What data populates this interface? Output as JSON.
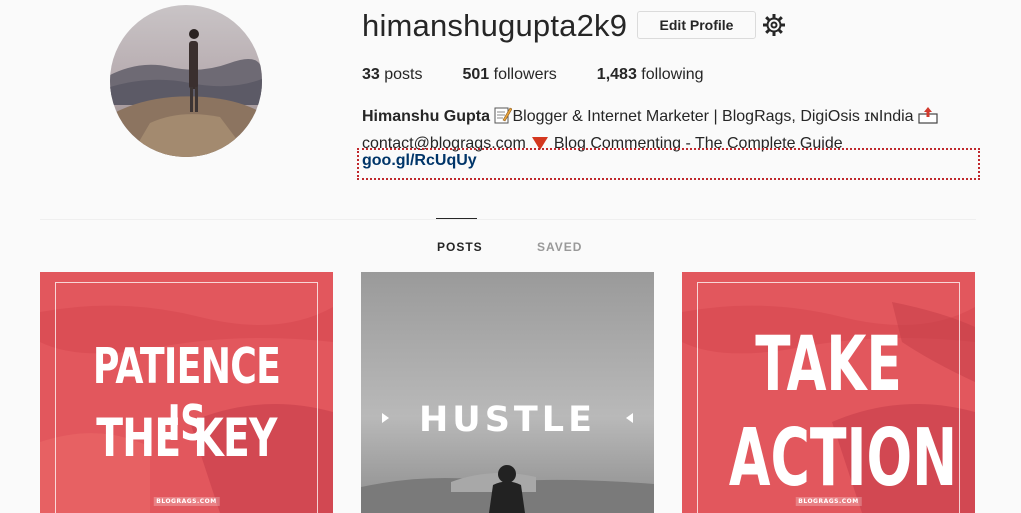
{
  "profile": {
    "username": "himanshugupta2k9",
    "edit_label": "Edit Profile",
    "stats": {
      "posts_count": "33",
      "posts_label": "posts",
      "followers_count": "501",
      "followers_label": "followers",
      "following_count": "1,483",
      "following_label": "following"
    },
    "bio": {
      "name": "Himanshu Gupta",
      "line1_text": "Blogger & Internet Marketer | BlogRags, DigiOsis ɪɴIndia",
      "email": "contact@blogrags.com",
      "line2_text": "Blog Commenting - The Complete Guide",
      "link": "goo.gl/RcUqUy"
    }
  },
  "tabs": [
    {
      "label": "POSTS",
      "active": true
    },
    {
      "label": "SAVED",
      "active": false
    }
  ],
  "posts": [
    {
      "line1": "PATIENCE IS",
      "line2": "THE KEY",
      "watermark": "BLOGRAGS.COM",
      "bg": "#e2575d"
    },
    {
      "line1": "HUSTLE",
      "bg": "#8f8f8f"
    },
    {
      "line1": "TAKE",
      "line2": "ACTION",
      "watermark": "BLOGRAGS.COM",
      "bg": "#e2575d"
    }
  ],
  "colors": {
    "link": "#003569",
    "link_outline": "#c0282d",
    "post_red": "#e2575d",
    "tab_inactive": "#999999"
  },
  "icons": {
    "settings": "gear-icon",
    "memo": "memo-icon",
    "outbox": "outbox-tray-icon",
    "triangle": "red-triangle-down-icon"
  }
}
